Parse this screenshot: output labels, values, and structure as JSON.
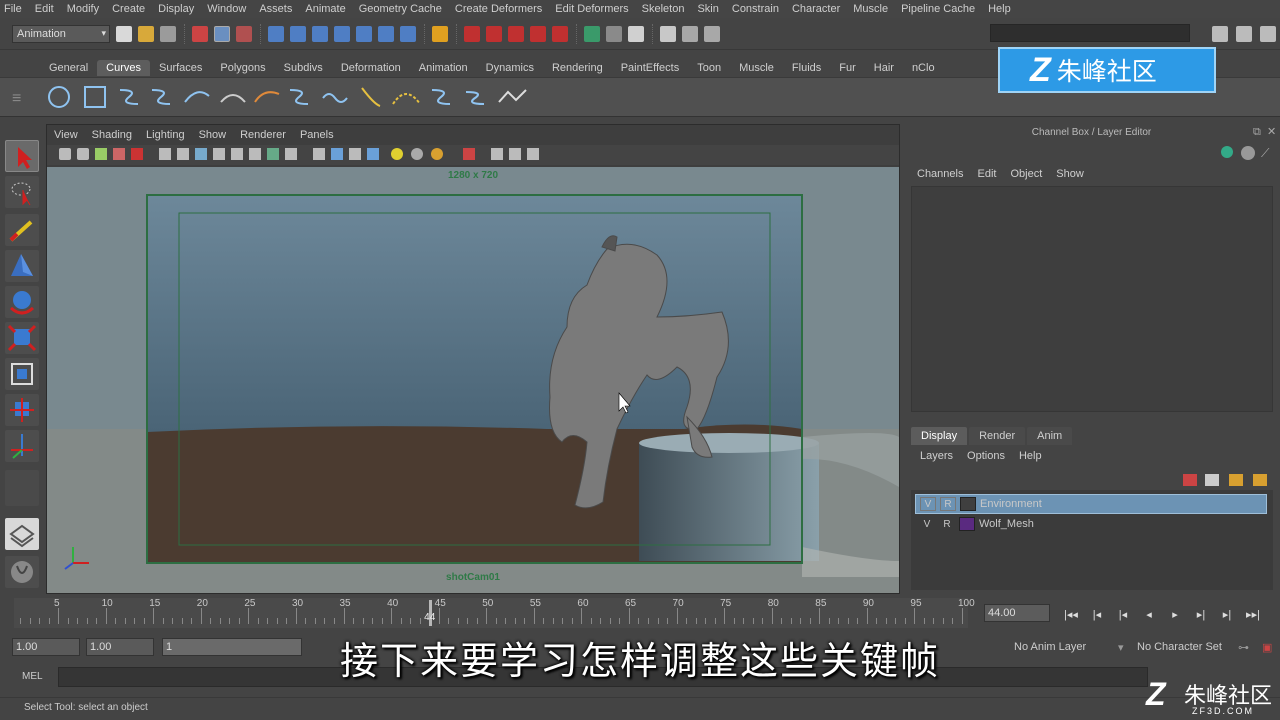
{
  "menubar": [
    "File",
    "Edit",
    "Modify",
    "Create",
    "Display",
    "Window",
    "Assets",
    "Animate",
    "Geometry Cache",
    "Create Deformers",
    "Edit Deformers",
    "Skeleton",
    "Skin",
    "Constrain",
    "Character",
    "Muscle",
    "Pipeline Cache",
    "Help"
  ],
  "toolbar": {
    "mode": "Animation"
  },
  "shelf": {
    "tabs": [
      "General",
      "Curves",
      "Surfaces",
      "Polygons",
      "Subdivs",
      "Deformation",
      "Animation",
      "Dynamics",
      "Rendering",
      "PaintEffects",
      "Toon",
      "Muscle",
      "Fluids",
      "Fur",
      "Hair",
      "nClo"
    ],
    "active": "Curves"
  },
  "logo": {
    "text": "朱峰社区"
  },
  "viewport": {
    "menu": [
      "View",
      "Shading",
      "Lighting",
      "Show",
      "Renderer",
      "Panels"
    ],
    "resolution": "1280 x 720",
    "camera": "shotCam01"
  },
  "channel_box": {
    "title": "Channel Box / Layer Editor",
    "menu": [
      "Channels",
      "Edit",
      "Object",
      "Show"
    ]
  },
  "layer_editor": {
    "tabs": [
      "Display",
      "Render",
      "Anim"
    ],
    "active_tab": "Display",
    "menu": [
      "Layers",
      "Options",
      "Help"
    ],
    "layers": [
      {
        "v": "V",
        "r": "R",
        "name": "Environment",
        "color": "#3f3f3f",
        "selected": true
      },
      {
        "v": "V",
        "r": "R",
        "name": "Wolf_Mesh",
        "color": "#5a2a80",
        "selected": false
      }
    ]
  },
  "timeline": {
    "labels": [
      "5",
      "10",
      "15",
      "20",
      "25",
      "30",
      "35",
      "40",
      "45",
      "50",
      "55",
      "60",
      "65",
      "70",
      "75",
      "80",
      "85",
      "90",
      "95",
      "100"
    ],
    "start": 1,
    "end": 100,
    "current": 44,
    "current_label": "44"
  },
  "current_frame": "44.00",
  "playback": [
    "|◂◂",
    "|◂",
    "|◂",
    "◂",
    "▸",
    "▸|",
    "▸|",
    "▸▸|"
  ],
  "range": {
    "start": "1.00",
    "anim_start": "1.00",
    "range_start": "1",
    "anim_layer": "No Anim Layer",
    "char_set": "No Character Set"
  },
  "cmdline": {
    "label": "MEL"
  },
  "helpline": {
    "text": "Select Tool: select an object"
  },
  "subtitle": "接下来要学习怎样调整这些关键帧",
  "watermark": {
    "text": "朱峰社区",
    "domain": "ZF3D.COM"
  },
  "colors": {
    "accent_blue": "#2d9ae6",
    "selection": "#6c93b4",
    "camera_frame": "#2f7a47"
  },
  "icons": [
    "select-tool-icon",
    "lasso-tool-icon",
    "paint-select-icon",
    "move-tool-icon",
    "rotate-tool-icon",
    "scale-tool-icon",
    "universal-manipulator-icon",
    "soft-mod-icon",
    "show-manipulator-icon",
    "single-pane-icon",
    "outliner-icon"
  ]
}
